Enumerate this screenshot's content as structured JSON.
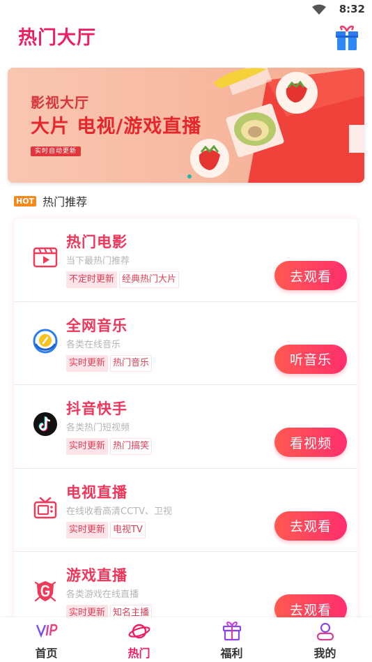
{
  "status_bar": {
    "time": "8:32",
    "wifi_icon": "wifi-icon"
  },
  "header": {
    "title": "热门大厅",
    "gift_icon": "gift-icon"
  },
  "banner": {
    "subtitle": "影视大厅",
    "headline": "大片 电视/游戏直播",
    "tag": "实时自动更新",
    "slides": 2,
    "active_slide": 2
  },
  "section": {
    "badge": "HOT",
    "title": "热门推荐"
  },
  "items": [
    {
      "name": "热门电影",
      "desc": "当下最热门推荐",
      "tags": [
        "不定时更新",
        "经典热门大片"
      ],
      "action": "去观看",
      "icon": "film-icon"
    },
    {
      "name": "全网音乐",
      "desc": "各类在线音乐",
      "tags": [
        "实时更新",
        "热门音乐"
      ],
      "action": "听音乐",
      "icon": "music-icon"
    },
    {
      "name": "抖音快手",
      "desc": "各类热门短视频",
      "tags": [
        "实时更新",
        "热门搞笑"
      ],
      "action": "看视频",
      "icon": "tiktok-icon"
    },
    {
      "name": "电视直播",
      "desc": "在线收看高清CCTV、卫视",
      "tags": [
        "实时更新",
        "电视TV"
      ],
      "action": "去观看",
      "icon": "tv-icon"
    },
    {
      "name": "游戏直播",
      "desc": "各类游戏在线直播",
      "tags": [
        "实时更新",
        "知名主播"
      ],
      "action": "去观看",
      "icon": "game-icon"
    }
  ],
  "nav": [
    {
      "label": "首页",
      "icon": "vip-icon",
      "active": false
    },
    {
      "label": "热门",
      "icon": "planet-icon",
      "active": true
    },
    {
      "label": "福利",
      "icon": "gift-icon",
      "active": false
    },
    {
      "label": "我的",
      "icon": "user-icon",
      "active": false
    }
  ],
  "colors": {
    "accent": "#ee1f60",
    "button_start": "#ff5a52",
    "button_end": "#ff2e6c",
    "hot_badge": "#f7891a"
  }
}
